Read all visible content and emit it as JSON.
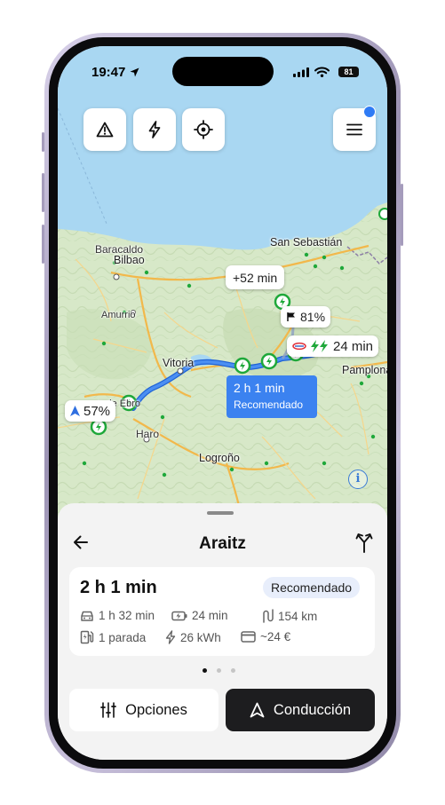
{
  "status": {
    "time": "19:47",
    "battery": "81"
  },
  "map": {
    "cities": [
      "Baracaldo",
      "Bilbao",
      "San Sebastián",
      "Amurrio",
      "Vitoria",
      "Pamplona",
      "Haro",
      "Logroño",
      "Miranda de Ebro"
    ],
    "delta_label": "+52 min",
    "battery_dest": "81%",
    "charger_time": "24 min",
    "battery_start": "57%",
    "route_time": "2 h 1 min",
    "route_tag": "Recomendado"
  },
  "sheet": {
    "title": "Araitz",
    "duration": "2 h 1 min",
    "badge": "Recomendado",
    "drive_time": "1 h 32 min",
    "charge_time": "24 min",
    "distance": "154 km",
    "stops": "1 parada",
    "energy": "26 kWh",
    "cost": "~24 €",
    "options_label": "Opciones",
    "drive_label": "Conducción"
  },
  "colors": {
    "route": "#3b82f0",
    "charger": "#1fa83a",
    "water": "#a9d7f2",
    "land": "#d7e8c8"
  }
}
